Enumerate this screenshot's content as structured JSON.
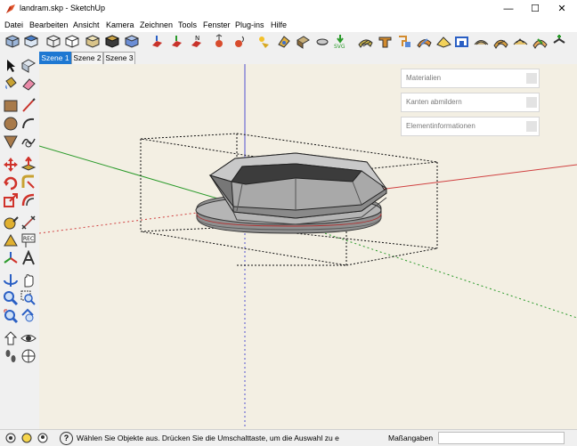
{
  "window": {
    "title": "landram.skp - SketchUp",
    "minimize": "—",
    "maximize": "☐",
    "close": "✕"
  },
  "menu": [
    "Datei",
    "Bearbeiten",
    "Ansicht",
    "Kamera",
    "Zeichnen",
    "Tools",
    "Fenster",
    "Plug-ins",
    "Hilfe"
  ],
  "tabs": [
    "Szene 1",
    "Szene 2",
    "Szene 3"
  ],
  "active_tab": "Szene 1",
  "panels": [
    "Materialien",
    "Kanten abmildern",
    "Elementinformationen"
  ],
  "status": {
    "text": "Wählen Sie Objekte aus. Drücken Sie die Umschalttaste, um die Auswahl zu e",
    "help": "?",
    "measure_label": "Maßangaben",
    "measure_value": ""
  },
  "colors": {
    "sky_ground": "#f3efe3",
    "axis_red": "#d04040",
    "axis_green": "#2a9a2a",
    "axis_blue": "#5050d0",
    "active_tab": "#1e78d2"
  }
}
